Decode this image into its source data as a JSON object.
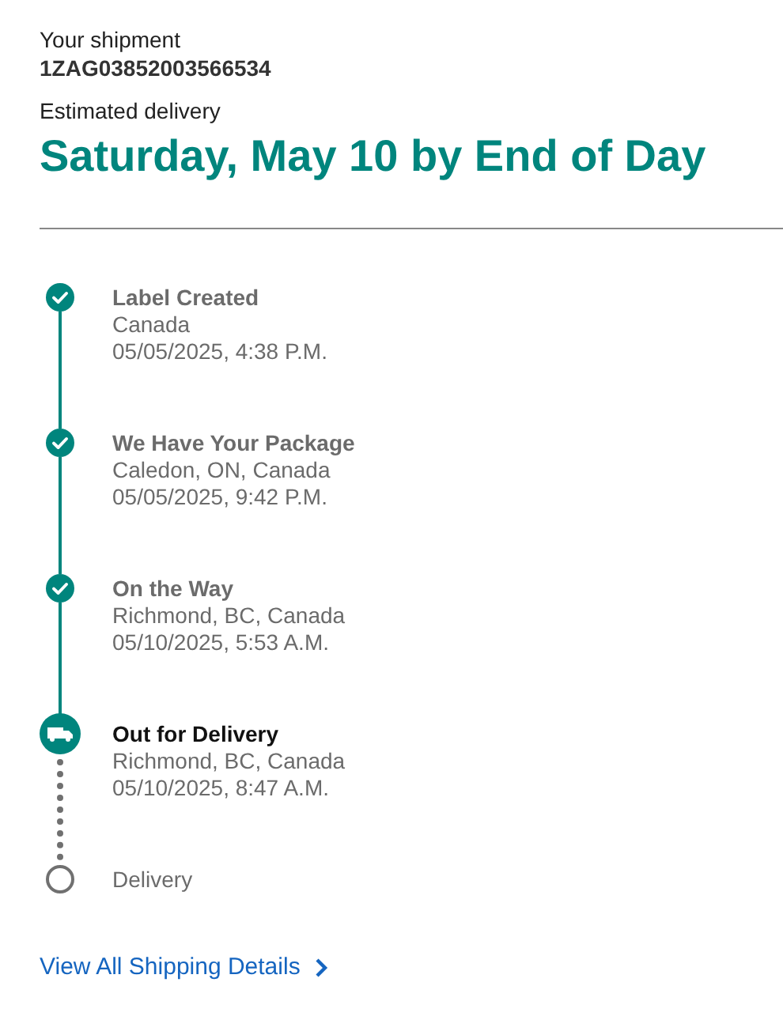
{
  "shipment": {
    "label": "Your shipment",
    "number": "1ZAG03852003566534"
  },
  "estimate": {
    "label": "Estimated delivery",
    "date": "Saturday, May 10 by End of Day"
  },
  "steps": [
    {
      "kind": "done",
      "title": "Label Created",
      "location": "Canada",
      "time": "05/05/2025, 4:38 P.M."
    },
    {
      "kind": "done",
      "title": "We Have Your Package",
      "location": "Caledon, ON, Canada",
      "time": "05/05/2025, 9:42 P.M."
    },
    {
      "kind": "done",
      "title": "On the Way",
      "location": "Richmond, BC, Canada",
      "time": "05/10/2025, 5:53 A.M."
    },
    {
      "kind": "current",
      "title": "Out for Delivery",
      "location": "Richmond, BC, Canada",
      "time": "05/10/2025, 8:47 A.M."
    },
    {
      "kind": "pending",
      "title": "Delivery"
    }
  ],
  "details_link": "View All Shipping Details"
}
